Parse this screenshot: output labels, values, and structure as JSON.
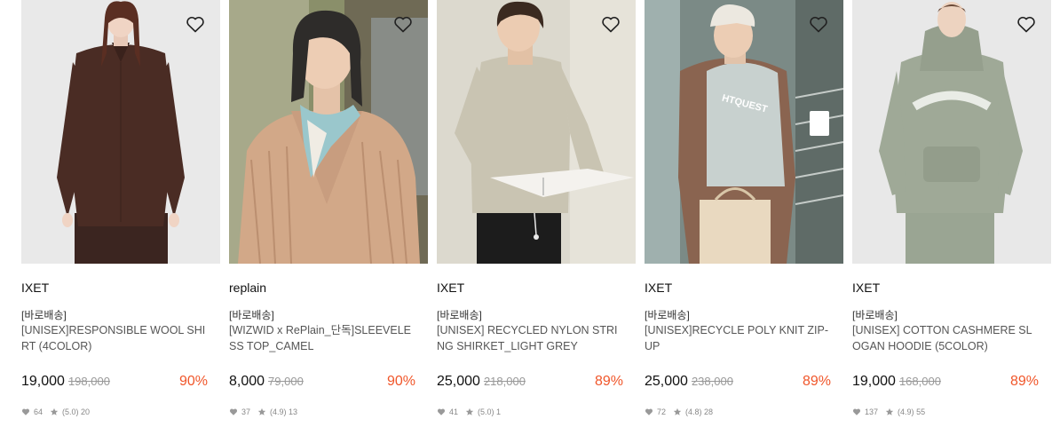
{
  "products": [
    {
      "brand": "IXET",
      "tag": "[바로배송]",
      "name": "[UNISEX]RESPONSIBLE WOOL SHIRT (4COLOR)",
      "price": "19,000",
      "original_price": "198,000",
      "discount": "90%",
      "likes": "64",
      "rating": "(5.0)",
      "reviews": "20",
      "image": "model-in-brown-wool-shirt"
    },
    {
      "brand": "replain",
      "tag": "[바로배송]",
      "name": "[WIZWID x RePlain_단독]SLEEVELESS TOP_CAMEL",
      "price": "8,000",
      "original_price": "79,000",
      "discount": "90%",
      "likes": "37",
      "rating": "(4.9)",
      "reviews": "13",
      "image": "model-in-camel-knit-with-scarf"
    },
    {
      "brand": "IXET",
      "tag": "[바로배송]",
      "name": "[UNISEX] RECYCLED NYLON STRING SHIRKET_LIGHT GREY",
      "price": "25,000",
      "original_price": "218,000",
      "discount": "89%",
      "likes": "41",
      "rating": "(5.0)",
      "reviews": "1",
      "image": "model-reading-in-grey-shirket"
    },
    {
      "brand": "IXET",
      "tag": "[바로배송]",
      "name": "[UNISEX]RECYCLE POLY KNIT ZIP-UP",
      "price": "25,000",
      "original_price": "238,000",
      "discount": "89%",
      "likes": "72",
      "rating": "(4.8)",
      "reviews": "28",
      "image": "model-in-brown-zip-up-with-bag"
    },
    {
      "brand": "IXET",
      "tag": "[바로배송]",
      "name": "[UNISEX] COTTON CASHMERE SLOGAN HOODIE (5COLOR)",
      "price": "19,000",
      "original_price": "168,000",
      "discount": "89%",
      "likes": "137",
      "rating": "(4.9)",
      "reviews": "55",
      "image": "model-in-sage-hoodie"
    }
  ],
  "icons": {
    "wishlist": "heart-outline-icon",
    "likes": "heart-icon",
    "rating": "star-icon"
  },
  "colors": {
    "discount": "#f0562a",
    "icon_grey": "#999999"
  }
}
